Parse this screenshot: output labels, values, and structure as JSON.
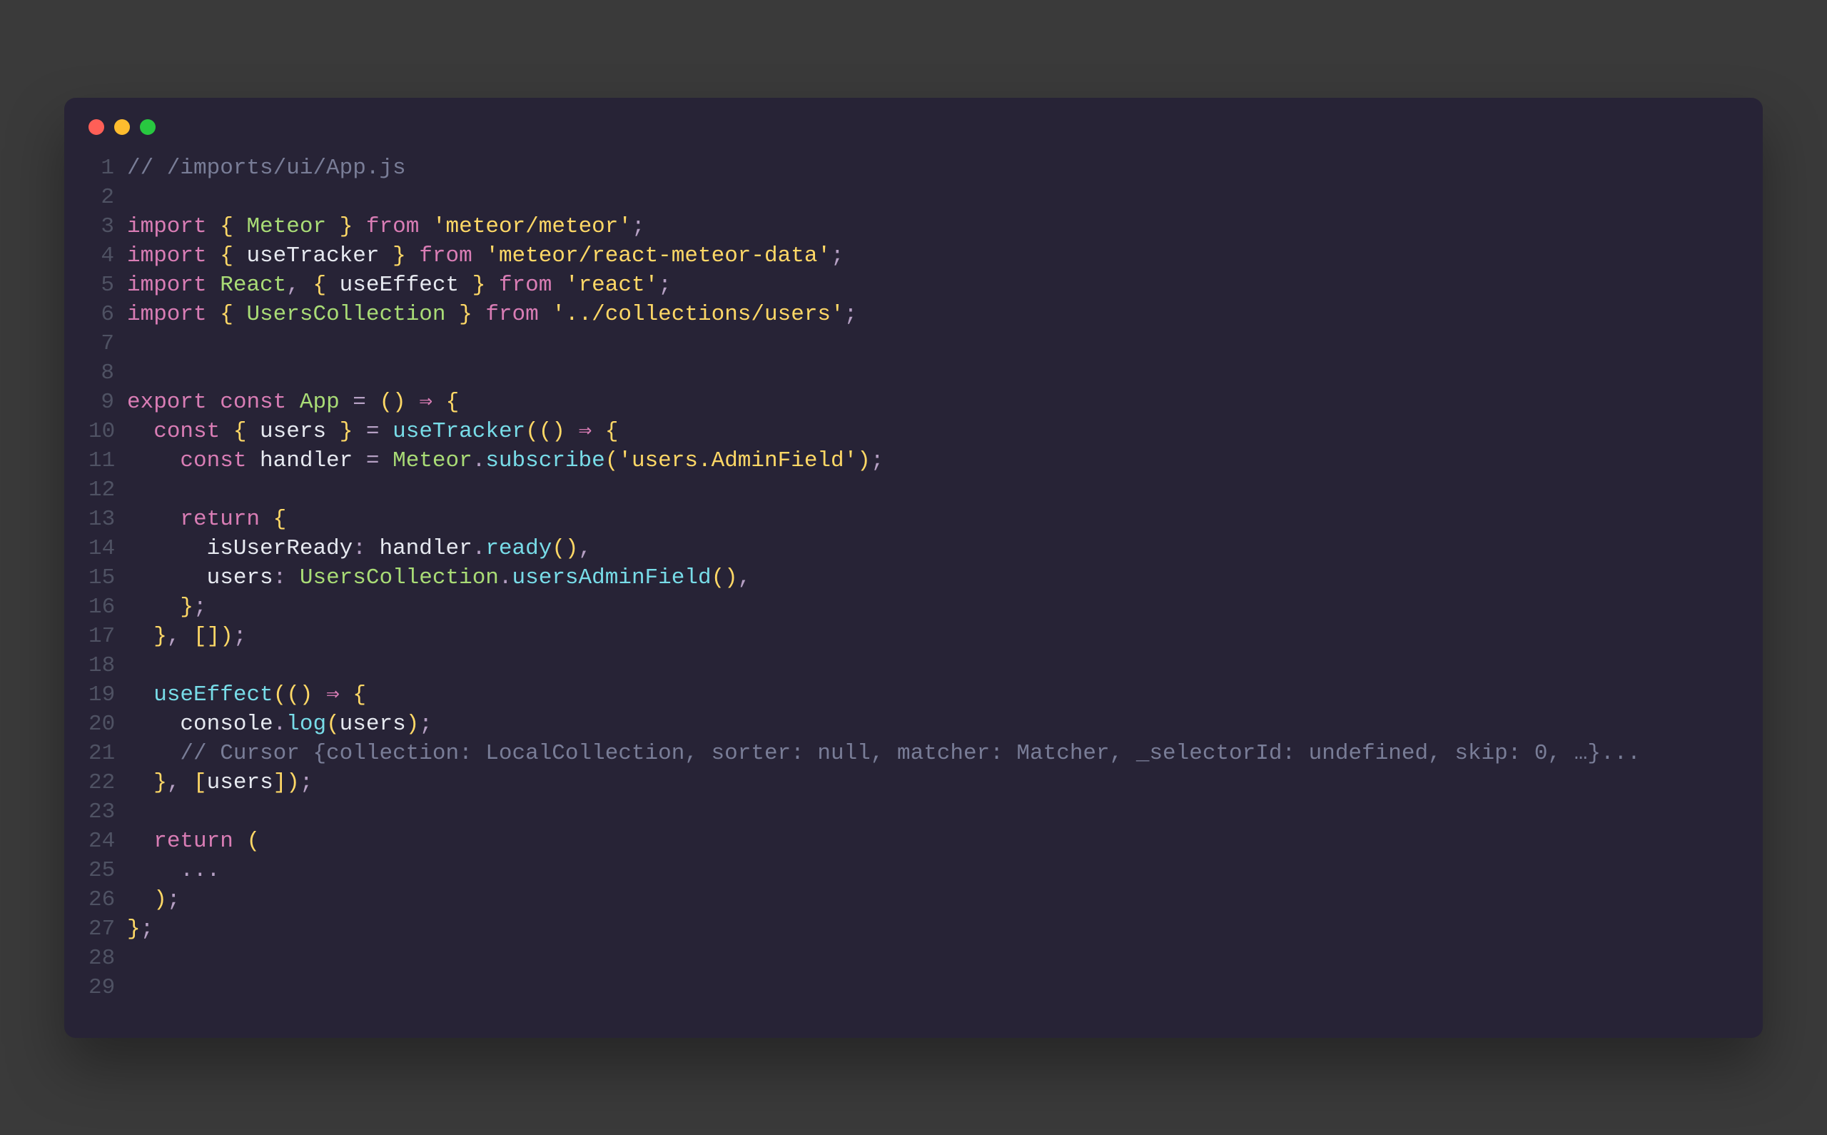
{
  "window": {
    "trafficLights": [
      "close",
      "minimize",
      "zoom"
    ]
  },
  "code": {
    "lines": [
      [
        {
          "t": "comment",
          "v": "// /imports/ui/App.js"
        }
      ],
      [],
      [
        {
          "t": "keyword",
          "v": "import"
        },
        {
          "t": "ident",
          "v": " "
        },
        {
          "t": "brace",
          "v": "{"
        },
        {
          "t": "ident",
          "v": " "
        },
        {
          "t": "type",
          "v": "Meteor"
        },
        {
          "t": "ident",
          "v": " "
        },
        {
          "t": "brace",
          "v": "}"
        },
        {
          "t": "ident",
          "v": " "
        },
        {
          "t": "keyword",
          "v": "from"
        },
        {
          "t": "ident",
          "v": " "
        },
        {
          "t": "string",
          "v": "'meteor/meteor'"
        },
        {
          "t": "punct",
          "v": ";"
        }
      ],
      [
        {
          "t": "keyword",
          "v": "import"
        },
        {
          "t": "ident",
          "v": " "
        },
        {
          "t": "brace",
          "v": "{"
        },
        {
          "t": "ident",
          "v": " useTracker "
        },
        {
          "t": "brace",
          "v": "}"
        },
        {
          "t": "ident",
          "v": " "
        },
        {
          "t": "keyword",
          "v": "from"
        },
        {
          "t": "ident",
          "v": " "
        },
        {
          "t": "string",
          "v": "'meteor/react-meteor-data'"
        },
        {
          "t": "punct",
          "v": ";"
        }
      ],
      [
        {
          "t": "keyword",
          "v": "import"
        },
        {
          "t": "ident",
          "v": " "
        },
        {
          "t": "type",
          "v": "React"
        },
        {
          "t": "punct",
          "v": ","
        },
        {
          "t": "ident",
          "v": " "
        },
        {
          "t": "brace",
          "v": "{"
        },
        {
          "t": "ident",
          "v": " useEffect "
        },
        {
          "t": "brace",
          "v": "}"
        },
        {
          "t": "ident",
          "v": " "
        },
        {
          "t": "keyword",
          "v": "from"
        },
        {
          "t": "ident",
          "v": " "
        },
        {
          "t": "string",
          "v": "'react'"
        },
        {
          "t": "punct",
          "v": ";"
        }
      ],
      [
        {
          "t": "keyword",
          "v": "import"
        },
        {
          "t": "ident",
          "v": " "
        },
        {
          "t": "brace",
          "v": "{"
        },
        {
          "t": "ident",
          "v": " "
        },
        {
          "t": "type",
          "v": "UsersCollection"
        },
        {
          "t": "ident",
          "v": " "
        },
        {
          "t": "brace",
          "v": "}"
        },
        {
          "t": "ident",
          "v": " "
        },
        {
          "t": "keyword",
          "v": "from"
        },
        {
          "t": "ident",
          "v": " "
        },
        {
          "t": "string",
          "v": "'../collections/users'"
        },
        {
          "t": "punct",
          "v": ";"
        }
      ],
      [],
      [],
      [
        {
          "t": "keyword",
          "v": "export"
        },
        {
          "t": "ident",
          "v": " "
        },
        {
          "t": "const",
          "v": "const"
        },
        {
          "t": "ident",
          "v": " "
        },
        {
          "t": "type",
          "v": "App"
        },
        {
          "t": "ident",
          "v": " "
        },
        {
          "t": "punct",
          "v": "="
        },
        {
          "t": "ident",
          "v": " "
        },
        {
          "t": "brace",
          "v": "()"
        },
        {
          "t": "ident",
          "v": " "
        },
        {
          "t": "arrow",
          "v": "⇒"
        },
        {
          "t": "ident",
          "v": " "
        },
        {
          "t": "brace",
          "v": "{"
        }
      ],
      [
        {
          "t": "ident",
          "v": "  "
        },
        {
          "t": "const",
          "v": "const"
        },
        {
          "t": "ident",
          "v": " "
        },
        {
          "t": "brace",
          "v": "{"
        },
        {
          "t": "ident",
          "v": " users "
        },
        {
          "t": "brace",
          "v": "}"
        },
        {
          "t": "ident",
          "v": " "
        },
        {
          "t": "punct",
          "v": "="
        },
        {
          "t": "ident",
          "v": " "
        },
        {
          "t": "func",
          "v": "useTracker"
        },
        {
          "t": "brace",
          "v": "(()"
        },
        {
          "t": "ident",
          "v": " "
        },
        {
          "t": "arrow",
          "v": "⇒"
        },
        {
          "t": "ident",
          "v": " "
        },
        {
          "t": "brace",
          "v": "{"
        }
      ],
      [
        {
          "t": "ident",
          "v": "    "
        },
        {
          "t": "const",
          "v": "const"
        },
        {
          "t": "ident",
          "v": " handler "
        },
        {
          "t": "punct",
          "v": "="
        },
        {
          "t": "ident",
          "v": " "
        },
        {
          "t": "type",
          "v": "Meteor"
        },
        {
          "t": "punct",
          "v": "."
        },
        {
          "t": "func",
          "v": "subscribe"
        },
        {
          "t": "brace",
          "v": "("
        },
        {
          "t": "string",
          "v": "'users.AdminField'"
        },
        {
          "t": "brace",
          "v": ")"
        },
        {
          "t": "punct",
          "v": ";"
        }
      ],
      [],
      [
        {
          "t": "ident",
          "v": "    "
        },
        {
          "t": "keyword",
          "v": "return"
        },
        {
          "t": "ident",
          "v": " "
        },
        {
          "t": "brace",
          "v": "{"
        }
      ],
      [
        {
          "t": "ident",
          "v": "      isUserReady"
        },
        {
          "t": "punct",
          "v": ":"
        },
        {
          "t": "ident",
          "v": " handler"
        },
        {
          "t": "punct",
          "v": "."
        },
        {
          "t": "func",
          "v": "ready"
        },
        {
          "t": "brace",
          "v": "()"
        },
        {
          "t": "punct",
          "v": ","
        }
      ],
      [
        {
          "t": "ident",
          "v": "      users"
        },
        {
          "t": "punct",
          "v": ":"
        },
        {
          "t": "ident",
          "v": " "
        },
        {
          "t": "type",
          "v": "UsersCollection"
        },
        {
          "t": "punct",
          "v": "."
        },
        {
          "t": "func",
          "v": "usersAdminField"
        },
        {
          "t": "brace",
          "v": "()"
        },
        {
          "t": "punct",
          "v": ","
        }
      ],
      [
        {
          "t": "ident",
          "v": "    "
        },
        {
          "t": "brace",
          "v": "}"
        },
        {
          "t": "punct",
          "v": ";"
        }
      ],
      [
        {
          "t": "ident",
          "v": "  "
        },
        {
          "t": "brace",
          "v": "}"
        },
        {
          "t": "punct",
          "v": ","
        },
        {
          "t": "ident",
          "v": " "
        },
        {
          "t": "brace",
          "v": "[])"
        },
        {
          "t": "punct",
          "v": ";"
        }
      ],
      [],
      [
        {
          "t": "ident",
          "v": "  "
        },
        {
          "t": "func",
          "v": "useEffect"
        },
        {
          "t": "brace",
          "v": "(()"
        },
        {
          "t": "ident",
          "v": " "
        },
        {
          "t": "arrow",
          "v": "⇒"
        },
        {
          "t": "ident",
          "v": " "
        },
        {
          "t": "brace",
          "v": "{"
        }
      ],
      [
        {
          "t": "ident",
          "v": "    console"
        },
        {
          "t": "punct",
          "v": "."
        },
        {
          "t": "func",
          "v": "log"
        },
        {
          "t": "brace",
          "v": "("
        },
        {
          "t": "ident",
          "v": "users"
        },
        {
          "t": "brace",
          "v": ")"
        },
        {
          "t": "punct",
          "v": ";"
        }
      ],
      [
        {
          "t": "ident",
          "v": "    "
        },
        {
          "t": "comment",
          "v": "// Cursor {collection: LocalCollection, sorter: null, matcher: Matcher, _selectorId: undefined, skip: 0, …}..."
        }
      ],
      [
        {
          "t": "ident",
          "v": "  "
        },
        {
          "t": "brace",
          "v": "}"
        },
        {
          "t": "punct",
          "v": ","
        },
        {
          "t": "ident",
          "v": " "
        },
        {
          "t": "brace",
          "v": "["
        },
        {
          "t": "ident",
          "v": "users"
        },
        {
          "t": "brace",
          "v": "])"
        },
        {
          "t": "punct",
          "v": ";"
        }
      ],
      [],
      [
        {
          "t": "ident",
          "v": "  "
        },
        {
          "t": "keyword",
          "v": "return"
        },
        {
          "t": "ident",
          "v": " "
        },
        {
          "t": "brace",
          "v": "("
        }
      ],
      [
        {
          "t": "ident",
          "v": "    "
        },
        {
          "t": "punct",
          "v": "..."
        }
      ],
      [
        {
          "t": "ident",
          "v": "  "
        },
        {
          "t": "brace",
          "v": ")"
        },
        {
          "t": "punct",
          "v": ";"
        }
      ],
      [
        {
          "t": "brace",
          "v": "}"
        },
        {
          "t": "punct",
          "v": ";"
        }
      ],
      [],
      []
    ]
  }
}
